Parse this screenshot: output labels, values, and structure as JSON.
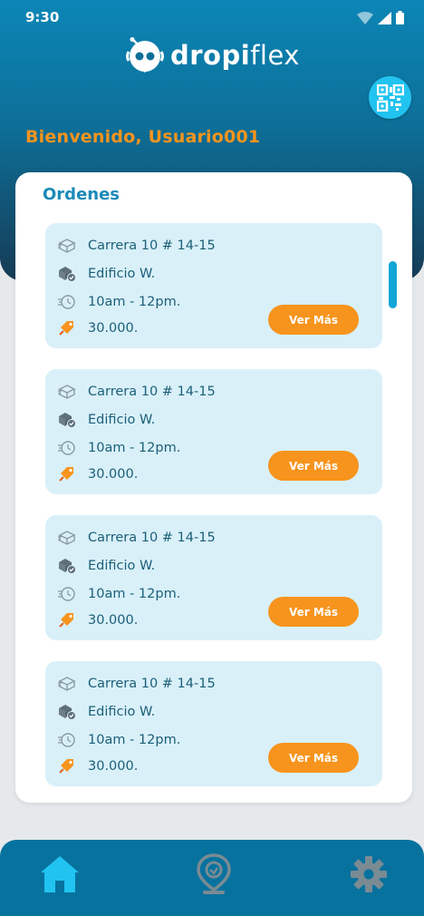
{
  "status_bar": {
    "time": "9:30"
  },
  "brand": {
    "name_bold": "dropi",
    "name_light": "flex"
  },
  "header": {
    "welcome": "Bienvenido, Usuario001"
  },
  "orders": {
    "title": "Ordenes",
    "items": [
      {
        "address": "Carrera 10 # 14-15",
        "building": "Edificio W.",
        "time_range": "10am - 12pm.",
        "price": "30.000.",
        "button": "Ver Más"
      },
      {
        "address": "Carrera 10 # 14-15",
        "building": "Edificio W.",
        "time_range": "10am - 12pm.",
        "price": "30.000.",
        "button": "Ver Más"
      },
      {
        "address": "Carrera 10 # 14-15",
        "building": "Edificio W.",
        "time_range": "10am - 12pm.",
        "price": "30.000.",
        "button": "Ver Más"
      },
      {
        "address": "Carrera 10 # 14-15",
        "building": "Edificio W.",
        "time_range": "10am - 12pm.",
        "price": "30.000.",
        "button": "Ver Más"
      }
    ]
  },
  "icons": {
    "qr": "qr-code-icon",
    "address": "box-icon",
    "building": "package-check-icon",
    "time": "clock-icon",
    "price": "price-tag-icon",
    "nav_home": "home-icon",
    "nav_location": "location-pin-icon",
    "nav_settings": "gear-icon"
  },
  "colors": {
    "accent_orange": "#f7941d",
    "primary_blue": "#0c86b6",
    "card_bg": "#d9f0f9",
    "nav_active": "#21c3f0"
  }
}
